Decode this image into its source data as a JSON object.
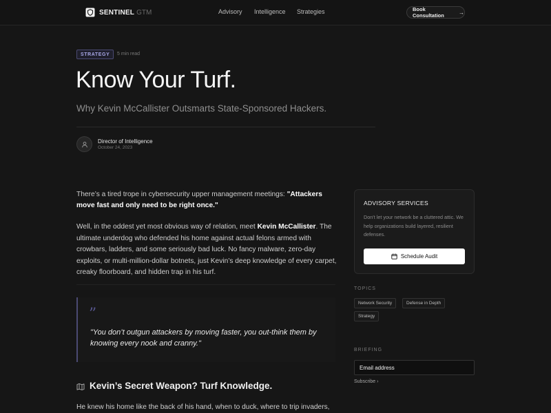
{
  "header": {
    "brand": "SENTINEL",
    "brand_sub": "GTM",
    "nav": [
      "Advisory",
      "Intelligence",
      "Strategies"
    ],
    "cta_label": "Book Consultation"
  },
  "article": {
    "tag": "STRATEGY",
    "read_time": "5 min read",
    "title": "Know Your Turf.",
    "subtitle": "Why Kevin McCallister Outsmarts State-Sponsored Hackers.",
    "author_role": "Director of Intelligence",
    "date": "October 24, 2023",
    "p1_pre": "There’s a tired trope in cybersecurity upper management meetings: ",
    "p1_bold": "\"Attackers move fast and only need to be right once.\"",
    "p2_pre": "Well, in the oddest yet most obvious way of relation, meet ",
    "p2_bold": "Kevin McCallister",
    "p2_post": ". The ultimate underdog who defended his home against actual felons armed with crowbars, ladders, and some seriously bad luck. No fancy malware, zero-day exploits, or multi-million-dollar botnets, just Kevin’s deep knowledge of every carpet, creaky floorboard, and hidden trap in his turf.",
    "quote_mark": "”",
    "quote": "\"You don’t outgun attackers by moving faster, you out-think them by knowing every nook and cranny.\"",
    "h2": "Kevin’s Secret Weapon? Turf Knowledge.",
    "p3": "He knew his home like the back of his hand, when to duck, where to trip invaders,"
  },
  "sidebar": {
    "card_title": "ADVISORY SERVICES",
    "card_desc": "Don’t let your network be a cluttered attic. We help organizations build layered, resilient defenses.",
    "audit_label": "Schedule Audit",
    "topics_label": "TOPICS",
    "topics": [
      "Network Security",
      "Defense in Depth",
      "Strategy"
    ],
    "briefing_label": "BRIEFING",
    "email_placeholder": "Email address",
    "subscribe_label": "Subscribe"
  },
  "colors": {
    "accent": "#a9a8e8",
    "background": "#161616"
  }
}
